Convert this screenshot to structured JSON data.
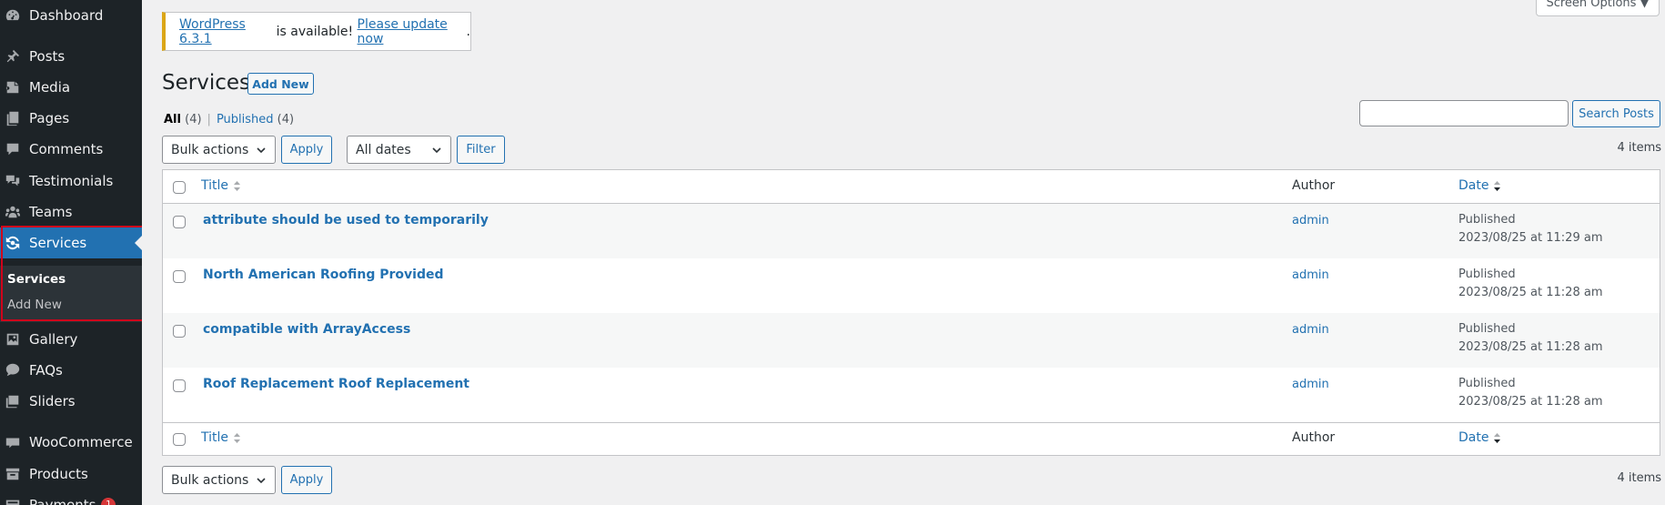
{
  "sidebar": {
    "items": [
      {
        "label": "Dashboard",
        "icon": "dashboard-icon"
      },
      {
        "label": "Posts",
        "icon": "pin-icon"
      },
      {
        "label": "Media",
        "icon": "media-icon"
      },
      {
        "label": "Pages",
        "icon": "pages-icon"
      },
      {
        "label": "Comments",
        "icon": "comment-icon"
      },
      {
        "label": "Testimonials",
        "icon": "testimonial-icon"
      },
      {
        "label": "Teams",
        "icon": "groups-icon"
      },
      {
        "label": "Services",
        "icon": "update-icon"
      },
      {
        "label": "Gallery",
        "icon": "gallery-icon"
      },
      {
        "label": "FAQs",
        "icon": "faq-icon"
      },
      {
        "label": "Sliders",
        "icon": "slides-icon"
      },
      {
        "label": "WooCommerce",
        "icon": "woocommerce-icon"
      },
      {
        "label": "Products",
        "icon": "archive-icon"
      },
      {
        "label": "Payments",
        "icon": "payment-icon",
        "badge": "1"
      }
    ],
    "submenu": {
      "active": "Services",
      "add_new": "Add New"
    }
  },
  "header": {
    "screen_options": "Screen Options ▼"
  },
  "notice": {
    "version_link": "WordPress 6.3.1",
    "middle": " is available! ",
    "update_link": "Please update now",
    "end": "."
  },
  "page": {
    "title": "Services",
    "add_new": "Add New"
  },
  "filters": {
    "all_label": "All",
    "all_count": "(4)",
    "published_label": "Published",
    "published_count": "(4)",
    "bulk_actions": "Bulk actions",
    "apply": "Apply",
    "all_dates": "All dates",
    "filter": "Filter",
    "search_button": "Search Posts",
    "items_count": "4 items"
  },
  "table": {
    "columns": {
      "title": "Title",
      "author": "Author",
      "date": "Date"
    },
    "rows": [
      {
        "title": "attribute should be used to temporarily",
        "author": "admin",
        "status": "Published",
        "date": "2023/08/25 at 11:29 am"
      },
      {
        "title": "North American Roofing Provided",
        "author": "admin",
        "status": "Published",
        "date": "2023/08/25 at 11:28 am"
      },
      {
        "title": "compatible with ArrayAccess",
        "author": "admin",
        "status": "Published",
        "date": "2023/08/25 at 11:28 am"
      },
      {
        "title": "Roof Replacement Roof Replacement",
        "author": "admin",
        "status": "Published",
        "date": "2023/08/25 at 11:28 am"
      }
    ]
  },
  "colors": {
    "sidebar_bg": "#1d2327",
    "accent": "#2271b1",
    "notice_border": "#dba617",
    "highlight": "#d0021b"
  }
}
